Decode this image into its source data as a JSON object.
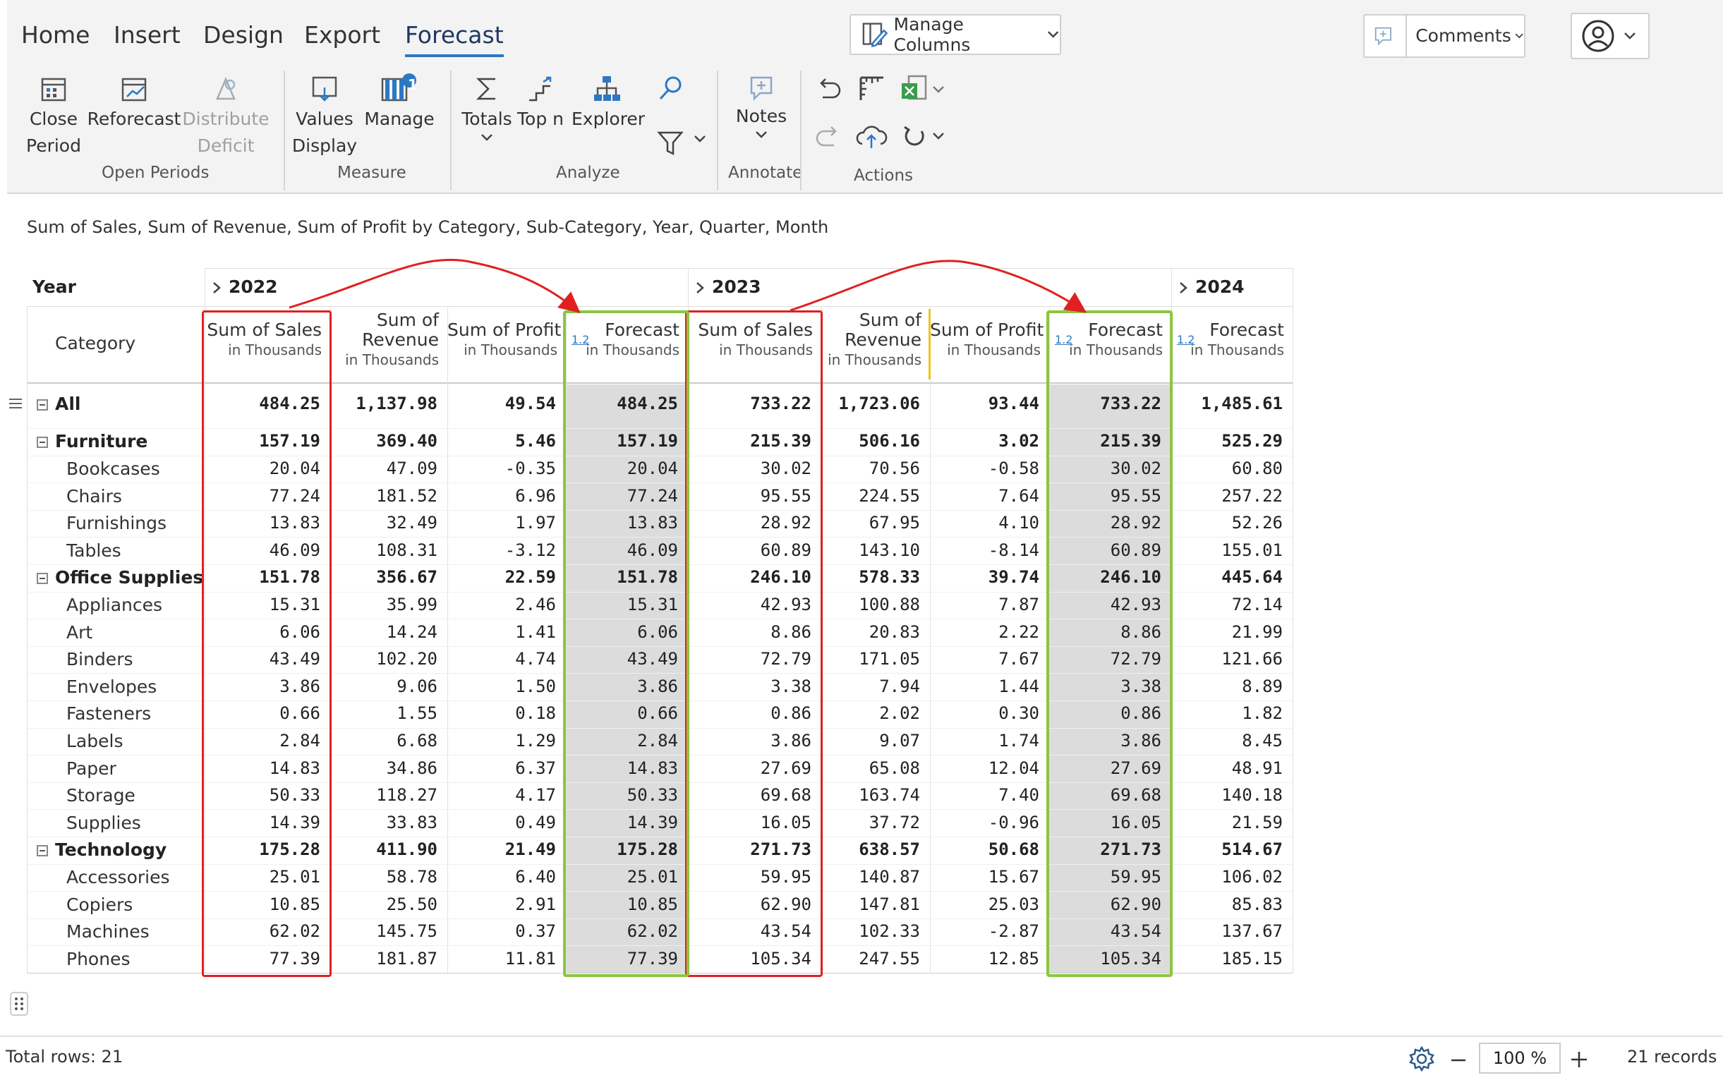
{
  "ribbon": {
    "tabs": [
      "Home",
      "Insert",
      "Design",
      "Export",
      "Forecast"
    ],
    "active_tab": "Forecast",
    "manage_columns": "Manage Columns",
    "comments": "Comments",
    "groups": {
      "open_periods": "Open Periods",
      "measure": "Measure",
      "analyze": "Analyze",
      "annotate": "Annotate",
      "actions": "Actions"
    },
    "buttons": {
      "close_period_1": "Close",
      "close_period_2": "Period",
      "reforecast": "Reforecast",
      "distribute_1": "Distribute",
      "distribute_2": "Deficit",
      "values_1": "Values",
      "values_2": "Display",
      "manage": "Manage",
      "manage_badge": "1",
      "totals": "Totals",
      "topn": "Top n",
      "explorer": "Explorer",
      "notes": "Notes"
    }
  },
  "report": {
    "subtitle": "Sum of Sales, Sum of Revenue, Sum of Profit by Category, Sub-Category, Year, Quarter, Month",
    "year_label": "Year",
    "category_label": "Category",
    "years": [
      "2022",
      "2023",
      "2024"
    ],
    "columns": [
      {
        "l1": "Sum of Sales",
        "l2": "",
        "sub": "in Thousands"
      },
      {
        "l1": "Sum of",
        "l2": "Revenue",
        "sub": "in Thousands"
      },
      {
        "l1": "Sum of Profit",
        "l2": "",
        "sub": "in Thousands"
      },
      {
        "l1": "Forecast",
        "l2": "",
        "sub": "in Thousands",
        "tag": "1.2"
      },
      {
        "l1": "Sum of Sales",
        "l2": "",
        "sub": "in Thousands"
      },
      {
        "l1": "Sum of",
        "l2": "Revenue",
        "sub": "in Thousands"
      },
      {
        "l1": "Sum of Profit",
        "l2": "",
        "sub": "in Thousands"
      },
      {
        "l1": "Forecast",
        "l2": "",
        "sub": "in Thousands",
        "tag": "1.2"
      },
      {
        "l1": "Forecast",
        "l2": "",
        "sub": "in Thousands",
        "tag": "1.2"
      }
    ],
    "rows": [
      {
        "label": "All",
        "level": 0,
        "values": [
          "484.25",
          "1,137.98",
          "49.54",
          "484.25",
          "733.22",
          "1,723.06",
          "93.44",
          "733.22",
          "1,485.61"
        ]
      },
      {
        "label": "Furniture",
        "level": 1,
        "values": [
          "157.19",
          "369.40",
          "5.46",
          "157.19",
          "215.39",
          "506.16",
          "3.02",
          "215.39",
          "525.29"
        ]
      },
      {
        "label": "Bookcases",
        "level": 2,
        "values": [
          "20.04",
          "47.09",
          "-0.35",
          "20.04",
          "30.02",
          "70.56",
          "-0.58",
          "30.02",
          "60.80"
        ]
      },
      {
        "label": "Chairs",
        "level": 2,
        "values": [
          "77.24",
          "181.52",
          "6.96",
          "77.24",
          "95.55",
          "224.55",
          "7.64",
          "95.55",
          "257.22"
        ]
      },
      {
        "label": "Furnishings",
        "level": 2,
        "values": [
          "13.83",
          "32.49",
          "1.97",
          "13.83",
          "28.92",
          "67.95",
          "4.10",
          "28.92",
          "52.26"
        ]
      },
      {
        "label": "Tables",
        "level": 2,
        "values": [
          "46.09",
          "108.31",
          "-3.12",
          "46.09",
          "60.89",
          "143.10",
          "-8.14",
          "60.89",
          "155.01"
        ]
      },
      {
        "label": "Office Supplies",
        "level": 1,
        "values": [
          "151.78",
          "356.67",
          "22.59",
          "151.78",
          "246.10",
          "578.33",
          "39.74",
          "246.10",
          "445.64"
        ]
      },
      {
        "label": "Appliances",
        "level": 2,
        "values": [
          "15.31",
          "35.99",
          "2.46",
          "15.31",
          "42.93",
          "100.88",
          "7.87",
          "42.93",
          "72.14"
        ]
      },
      {
        "label": "Art",
        "level": 2,
        "values": [
          "6.06",
          "14.24",
          "1.41",
          "6.06",
          "8.86",
          "20.83",
          "2.22",
          "8.86",
          "21.99"
        ]
      },
      {
        "label": "Binders",
        "level": 2,
        "values": [
          "43.49",
          "102.20",
          "4.74",
          "43.49",
          "72.79",
          "171.05",
          "7.67",
          "72.79",
          "121.66"
        ]
      },
      {
        "label": "Envelopes",
        "level": 2,
        "values": [
          "3.86",
          "9.06",
          "1.50",
          "3.86",
          "3.38",
          "7.94",
          "1.44",
          "3.38",
          "8.89"
        ]
      },
      {
        "label": "Fasteners",
        "level": 2,
        "values": [
          "0.66",
          "1.55",
          "0.18",
          "0.66",
          "0.86",
          "2.02",
          "0.30",
          "0.86",
          "1.82"
        ]
      },
      {
        "label": "Labels",
        "level": 2,
        "values": [
          "2.84",
          "6.68",
          "1.29",
          "2.84",
          "3.86",
          "9.07",
          "1.74",
          "3.86",
          "8.45"
        ]
      },
      {
        "label": "Paper",
        "level": 2,
        "values": [
          "14.83",
          "34.86",
          "6.37",
          "14.83",
          "27.69",
          "65.08",
          "12.04",
          "27.69",
          "48.91"
        ]
      },
      {
        "label": "Storage",
        "level": 2,
        "values": [
          "50.33",
          "118.27",
          "4.17",
          "50.33",
          "69.68",
          "163.74",
          "7.40",
          "69.68",
          "140.18"
        ]
      },
      {
        "label": "Supplies",
        "level": 2,
        "values": [
          "14.39",
          "33.83",
          "0.49",
          "14.39",
          "16.05",
          "37.72",
          "-0.96",
          "16.05",
          "21.59"
        ]
      },
      {
        "label": "Technology",
        "level": 1,
        "values": [
          "175.28",
          "411.90",
          "21.49",
          "175.28",
          "271.73",
          "638.57",
          "50.68",
          "271.73",
          "514.67"
        ]
      },
      {
        "label": "Accessories",
        "level": 2,
        "values": [
          "25.01",
          "58.78",
          "6.40",
          "25.01",
          "59.95",
          "140.87",
          "15.67",
          "59.95",
          "106.02"
        ]
      },
      {
        "label": "Copiers",
        "level": 2,
        "values": [
          "10.85",
          "25.50",
          "2.91",
          "10.85",
          "62.90",
          "147.81",
          "25.03",
          "62.90",
          "85.83"
        ]
      },
      {
        "label": "Machines",
        "level": 2,
        "values": [
          "62.02",
          "145.75",
          "0.37",
          "62.02",
          "43.54",
          "102.33",
          "-2.87",
          "43.54",
          "137.67"
        ]
      },
      {
        "label": "Phones",
        "level": 2,
        "values": [
          "77.39",
          "181.87",
          "11.81",
          "77.39",
          "105.34",
          "247.55",
          "12.85",
          "105.34",
          "185.15"
        ]
      }
    ]
  },
  "footer": {
    "total_rows": "Total rows: 21",
    "zoom": "100 %",
    "records": "21 records"
  },
  "colors": {
    "highlight_red": "#e02020",
    "highlight_green": "#8cc63f",
    "forecast_fill": "#dcdcdc",
    "accent": "#2b78c5"
  }
}
